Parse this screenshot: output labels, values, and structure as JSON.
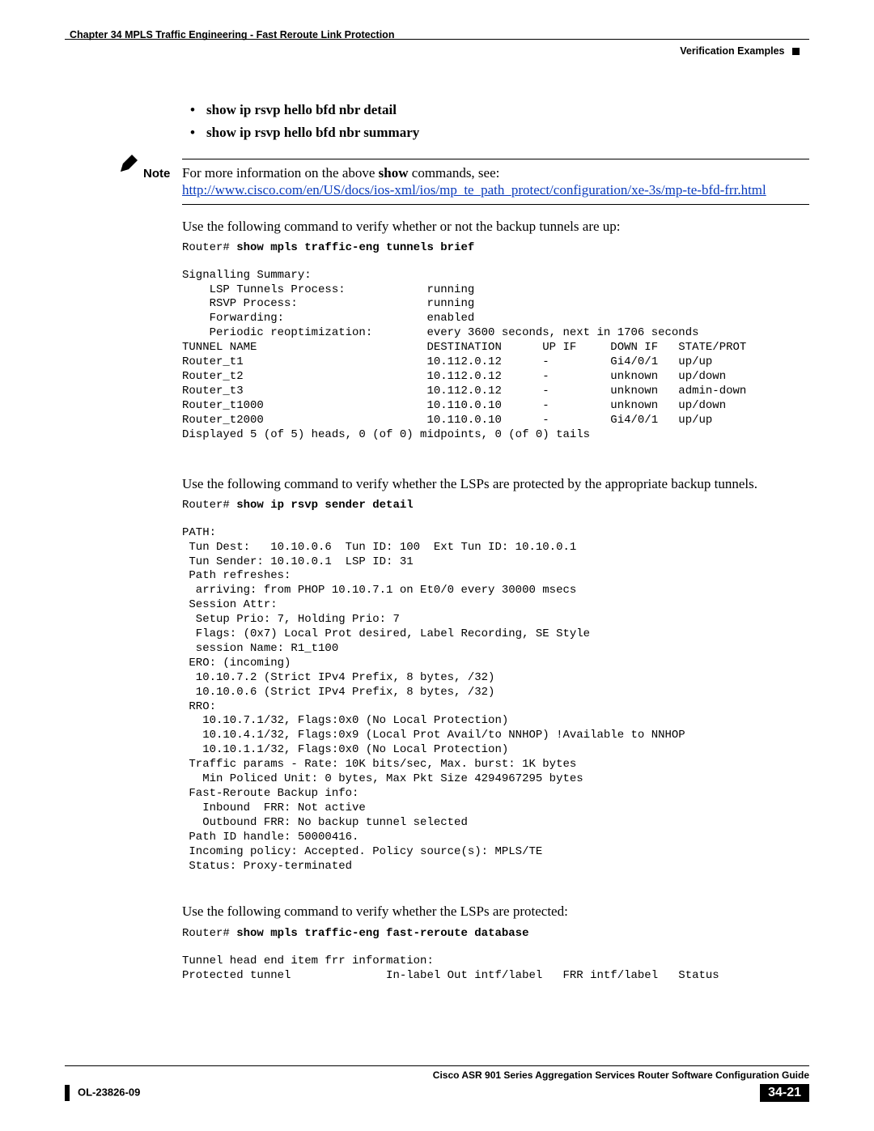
{
  "header": {
    "chapter": "Chapter 34    MPLS Traffic Engineering - Fast Reroute Link Protection",
    "section": "Verification Examples"
  },
  "bullets": {
    "b1": "show ip rsvp hello bfd nbr detail",
    "b2": "show ip rsvp hello bfd nbr summary"
  },
  "note": {
    "label": "Note",
    "text_prefix": "For more information on the above ",
    "show_bold": "show",
    "text_mid": " commands, see:",
    "link": "http://www.cisco.com/en/US/docs/ios-xml/ios/mp_te_path_protect/configuration/xe-3s/mp-te-bfd-frr.html"
  },
  "para1": "Use the following command to verify whether or not the backup tunnels are up:",
  "cmd1_prompt": "Router# ",
  "cmd1": "show mpls traffic-eng tunnels brief",
  "output1": "\nSignalling Summary:\n    LSP Tunnels Process:            running\n    RSVP Process:                   running\n    Forwarding:                     enabled\n    Periodic reoptimization:        every 3600 seconds, next in 1706 seconds\nTUNNEL NAME                         DESTINATION      UP IF     DOWN IF   STATE/PROT\nRouter_t1                           10.112.0.12      -         Gi4/0/1   up/up\nRouter_t2                           10.112.0.12      -         unknown   up/down\nRouter_t3                           10.112.0.12      -         unknown   admin-down\nRouter_t1000                        10.110.0.10      -         unknown   up/down\nRouter_t2000                        10.110.0.10      -         Gi4/0/1   up/up\nDisplayed 5 (of 5) heads, 0 (of 0) midpoints, 0 (of 0) tails",
  "para2": "Use the following command to verify whether the LSPs are protected by the appropriate backup tunnels.",
  "cmd2_prompt": "Router# ",
  "cmd2": "show ip rsvp sender detail",
  "output2": "\nPATH:\n Tun Dest:   10.10.0.6  Tun ID: 100  Ext Tun ID: 10.10.0.1\n Tun Sender: 10.10.0.1  LSP ID: 31\n Path refreshes:\n  arriving: from PHOP 10.10.7.1 on Et0/0 every 30000 msecs\n Session Attr:\n  Setup Prio: 7, Holding Prio: 7\n  Flags: (0x7) Local Prot desired, Label Recording, SE Style\n  session Name: R1_t100\n ERO: (incoming)\n  10.10.7.2 (Strict IPv4 Prefix, 8 bytes, /32)\n  10.10.0.6 (Strict IPv4 Prefix, 8 bytes, /32)\n RRO:\n   10.10.7.1/32, Flags:0x0 (No Local Protection)\n   10.10.4.1/32, Flags:0x9 (Local Prot Avail/to NNHOP) !Available to NNHOP\n   10.10.1.1/32, Flags:0x0 (No Local Protection)\n Traffic params - Rate: 10K bits/sec, Max. burst: 1K bytes\n   Min Policed Unit: 0 bytes, Max Pkt Size 4294967295 bytes\n Fast-Reroute Backup info:\n   Inbound  FRR: Not active\n   Outbound FRR: No backup tunnel selected\n Path ID handle: 50000416.\n Incoming policy: Accepted. Policy source(s): MPLS/TE\n Status: Proxy-terminated",
  "para3": "Use the following command to verify whether the LSPs are protected:",
  "cmd3_prompt": "Router# ",
  "cmd3": "show mpls traffic-eng fast-reroute database",
  "output3": "\nTunnel head end item frr information:\nProtected tunnel              In-label Out intf/label   FRR intf/label   Status",
  "footer": {
    "title": "Cisco ASR 901 Series Aggregation Services Router Software Configuration Guide",
    "doc": "OL-23826-09",
    "page": "34-21"
  }
}
